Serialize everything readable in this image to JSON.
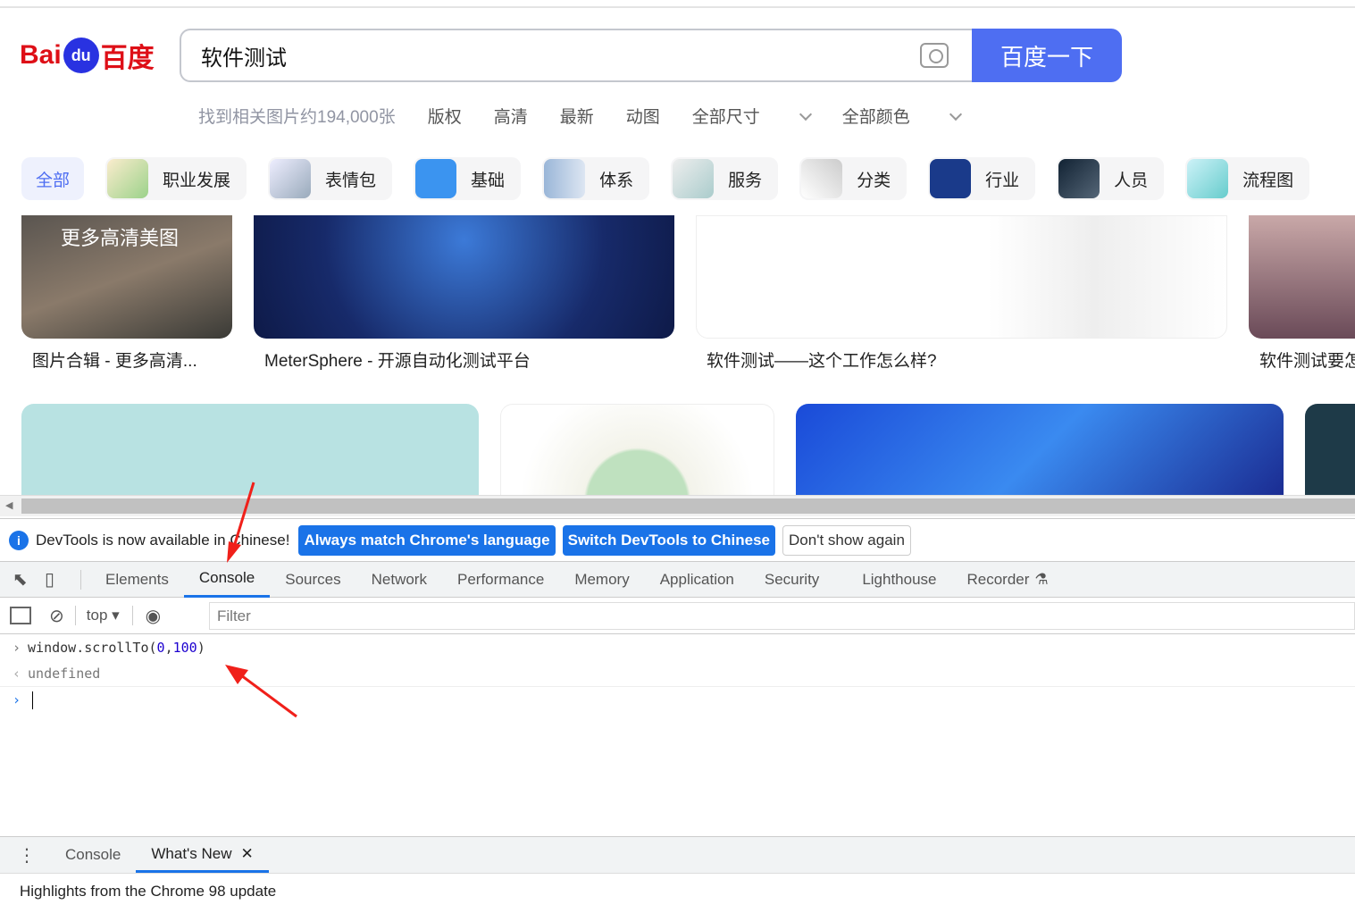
{
  "search": {
    "logo_text": "Bai",
    "logo_paw": "du",
    "logo_cn": "百度",
    "query": "软件测试",
    "button": "百度一下",
    "camera_icon": "camera-icon"
  },
  "filters": {
    "count": "找到相关图片约194,000张",
    "items": [
      "版权",
      "高清",
      "最新",
      "动图"
    ],
    "dropdowns": [
      "全部尺寸",
      "全部颜色"
    ]
  },
  "chips": [
    "全部",
    "职业发展",
    "表情包",
    "基础",
    "体系",
    "服务",
    "分类",
    "行业",
    "人员",
    "流程图"
  ],
  "results": [
    {
      "caption": "图片合辑 - 更多高清...",
      "overlay": "更多高清美图"
    },
    {
      "caption": "MeterSphere - 开源自动化测试平台"
    },
    {
      "caption": "软件测试——这个工作怎么样?"
    },
    {
      "caption": "软件测试要怎"
    }
  ],
  "devtools": {
    "info": {
      "text": "DevTools is now available in Chinese!",
      "btn1": "Always match Chrome's language",
      "btn2": "Switch DevTools to Chinese",
      "btn3": "Don't show again"
    },
    "tabs": [
      "Elements",
      "Console",
      "Sources",
      "Network",
      "Performance",
      "Memory",
      "Application",
      "Security",
      "Lighthouse",
      "Recorder"
    ],
    "active_tab": "Console",
    "context": "top",
    "filter_placeholder": "Filter",
    "console": {
      "cmd_prefix": "window.scrollTo(",
      "arg1": "0",
      "comma": ",",
      "arg2": "100",
      "cmd_suffix": ")",
      "result": "undefined"
    },
    "drawer": {
      "tabs": [
        "Console",
        "What's New"
      ],
      "content": "Highlights from the Chrome 98 update"
    }
  },
  "colors": {
    "baidu_blue": "#4e6ef2",
    "devtools_blue": "#1a73e8",
    "arrow_red": "#f0201a"
  }
}
